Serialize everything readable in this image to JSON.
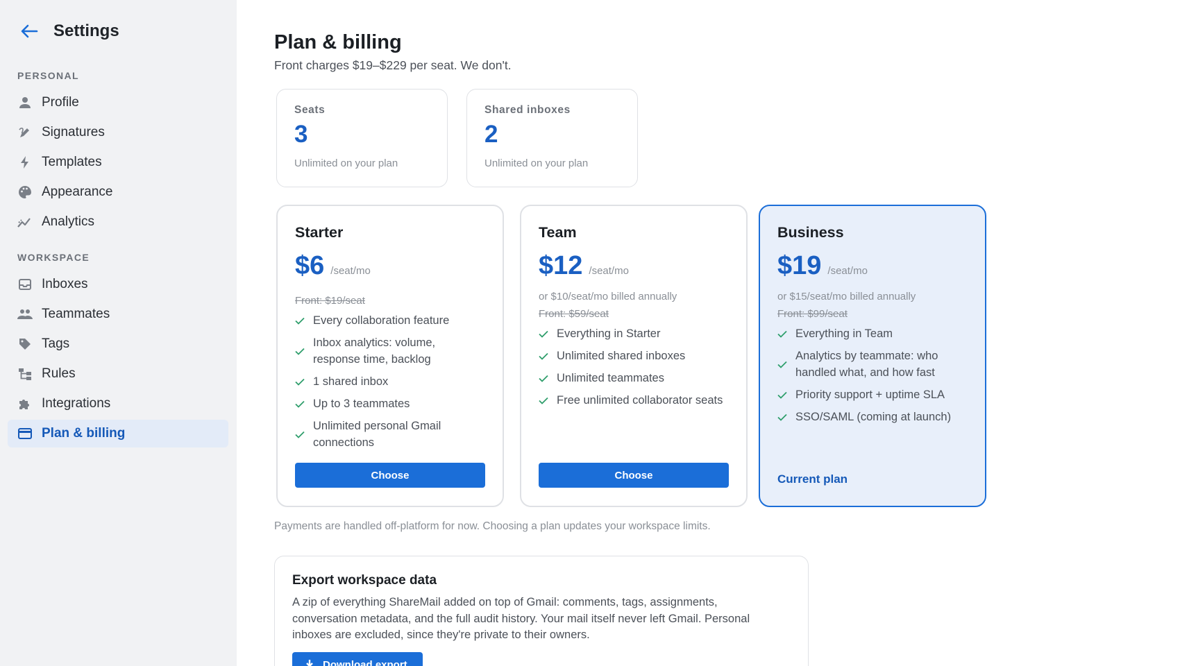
{
  "sidebar": {
    "title": "Settings",
    "sections": {
      "personal": "PERSONAL",
      "workspace": "WORKSPACE"
    },
    "personal_items": [
      {
        "label": "Profile",
        "icon": "person-icon"
      },
      {
        "label": "Signatures",
        "icon": "signature-icon"
      },
      {
        "label": "Templates",
        "icon": "bolt-icon"
      },
      {
        "label": "Appearance",
        "icon": "palette-icon"
      },
      {
        "label": "Analytics",
        "icon": "analytics-icon"
      }
    ],
    "workspace_items": [
      {
        "label": "Inboxes",
        "icon": "inbox-icon"
      },
      {
        "label": "Teammates",
        "icon": "people-icon"
      },
      {
        "label": "Tags",
        "icon": "tag-icon"
      },
      {
        "label": "Rules",
        "icon": "rules-icon"
      },
      {
        "label": "Integrations",
        "icon": "puzzle-icon"
      },
      {
        "label": "Plan & billing",
        "icon": "card-icon",
        "active": true
      }
    ]
  },
  "header": {
    "title": "Plan & billing",
    "subtitle": "Front charges $19–$229 per seat. We don't."
  },
  "stats": [
    {
      "label": "Seats",
      "value": "3",
      "note": "Unlimited on your plan"
    },
    {
      "label": "Shared inboxes",
      "value": "2",
      "note": "Unlimited on your plan"
    }
  ],
  "plans": [
    {
      "name": "Starter",
      "price": "$6",
      "unit": "/seat/mo",
      "annual": "",
      "front": "Front: $19/seat",
      "features": [
        "Every collaboration feature",
        "Inbox analytics: volume, response time, backlog",
        "1 shared inbox",
        "Up to 3 teammates",
        "Unlimited personal Gmail connections"
      ],
      "button": "Choose"
    },
    {
      "name": "Team",
      "price": "$12",
      "unit": "/seat/mo",
      "annual": "or $10/seat/mo billed annually",
      "front": "Front: $59/seat",
      "features": [
        "Everything in Starter",
        "Unlimited shared inboxes",
        "Unlimited teammates",
        "Free unlimited collaborator seats"
      ],
      "button": "Choose"
    },
    {
      "name": "Business",
      "price": "$19",
      "unit": "/seat/mo",
      "annual": "or $15/seat/mo billed annually",
      "front": "Front: $99/seat",
      "features": [
        "Everything in Team",
        "Analytics by teammate: who handled what, and how fast",
        "Priority support + uptime SLA",
        "SSO/SAML (coming at launch)"
      ],
      "current_label": "Current plan"
    }
  ],
  "payments_note": "Payments are handled off-platform for now. Choosing a plan updates your workspace limits.",
  "export": {
    "title": "Export workspace data",
    "description": "A zip of everything ShareMail added on top of Gmail: comments, tags, assignments, conversation metadata, and the full audit history. Your mail itself never left Gmail. Personal inboxes are excluded, since they're private to their owners.",
    "button": "Download export"
  },
  "colors": {
    "accent": "#1b6ed8",
    "accent_text": "#1a5fc2",
    "sidebar_bg": "#f1f2f4",
    "active_bg": "#e3ebf8",
    "current_plan_bg": "#e8effa",
    "check": "#2e9e6b"
  }
}
